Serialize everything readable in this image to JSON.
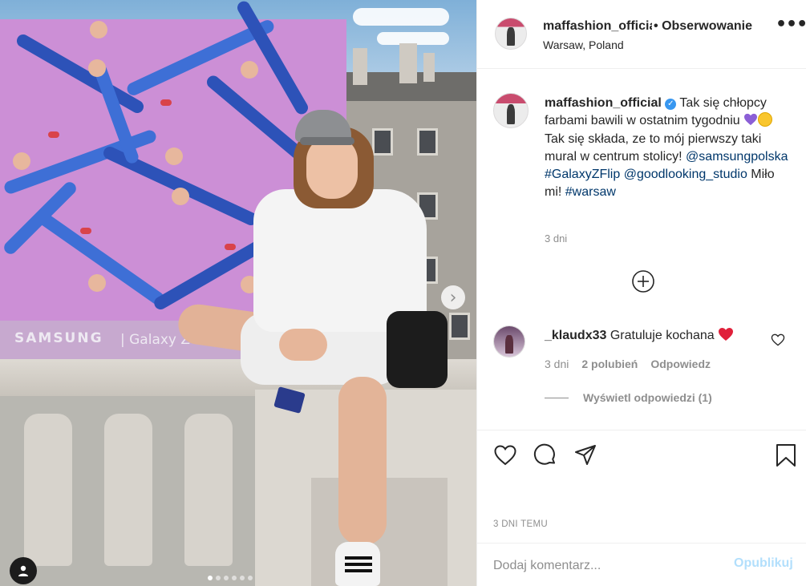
{
  "post": {
    "images_count": 6,
    "active_image_index": 0,
    "mural_brand": "SAMSUNG",
    "mural_product": "| Galaxy Z F"
  },
  "header": {
    "username": "maffashion_official",
    "separator": "•",
    "follow_label": "Obserwowanie",
    "location": "Warsaw, Poland",
    "more_glyph": "•••"
  },
  "caption": {
    "username": "maffashion_official",
    "verified_glyph": "✓",
    "text_1": " Tak się chłopcy farbami bawili w ostatnim tygodniu ",
    "text_2": " Tak się składa, ze to mój pierwszy taki mural w centrum stolicy! ",
    "mention_1": "@samsungpolska",
    "hashtag_1": "#GalaxyZFlip",
    "mention_2": "@goodlooking_studio",
    "text_3": " Miło mi! ",
    "hashtag_2": "#warsaw",
    "time": "3 dni"
  },
  "comment": {
    "username": "_klaudx33",
    "text": " Gratuluje kochana ",
    "time": "3 dni",
    "likes": "2 polubień",
    "reply_label": "Odpowiedz",
    "view_replies": "Wyświetl odpowiedzi (1)"
  },
  "footer": {
    "date": "3 DNI TEMU",
    "comment_placeholder": "Dodaj komentarz...",
    "post_label": "Opublikuj"
  },
  "colors": {
    "link": "#00376b",
    "verified": "#3897f0",
    "muted": "#8e8e8e",
    "post_disabled": "#b2dffc"
  }
}
